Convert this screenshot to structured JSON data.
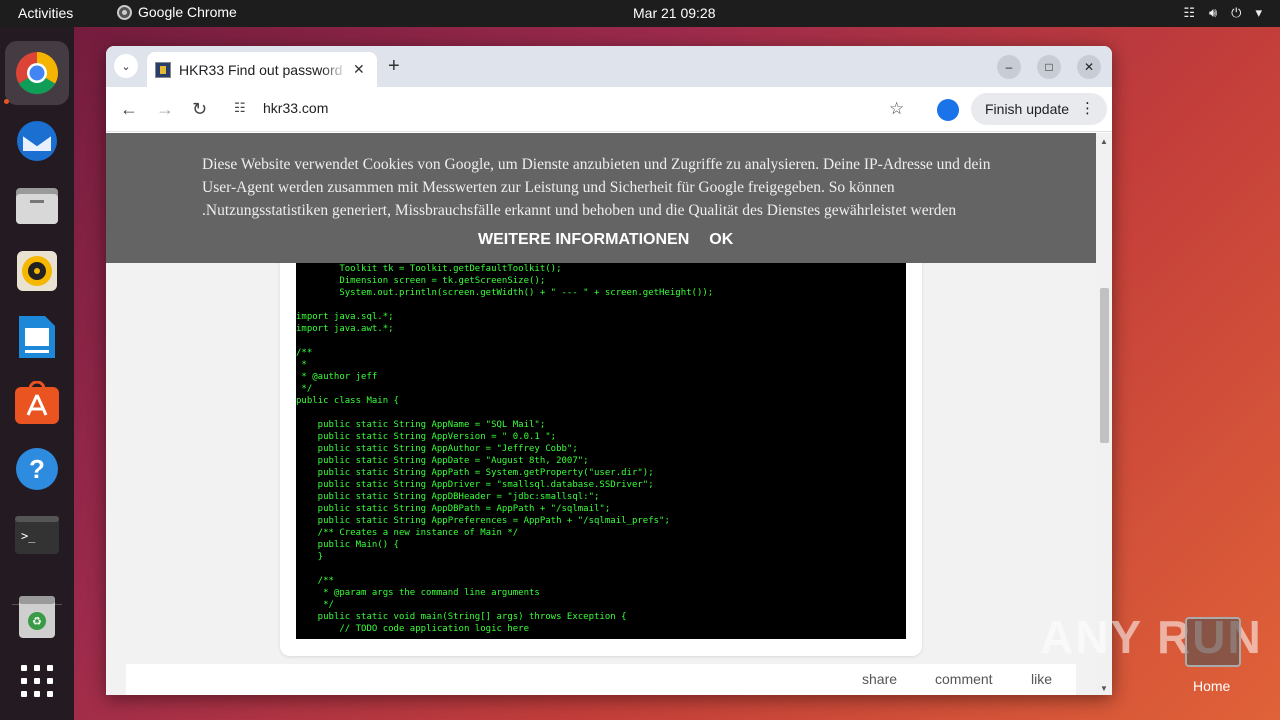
{
  "topbar": {
    "activities": "Activities",
    "app_name": "Google Chrome",
    "clock": "Mar 21  09:28"
  },
  "dock": {
    "items": [
      "chrome-icon",
      "thunderbird-icon",
      "files-icon",
      "rhythmbox-icon",
      "writer-icon",
      "app-center-icon",
      "help-icon",
      "terminal-icon",
      "trash-icon",
      "apps-grid-icon"
    ]
  },
  "browser": {
    "tab_title": "HKR33 Find out password",
    "url": "hkr33.com",
    "finish_update": "Finish update"
  },
  "cookie_banner": {
    "text": "Diese Website verwendet Cookies von Google, um Dienste anzubieten und Zugriffe zu analysieren. Deine IP-Adresse und dein User-Agent werden zusammen mit Messwerten zur Leistung und Sicherheit für Google freigegeben. So können .Nutzungsstatistiken generiert, Missbrauchsfälle erkannt und behoben und die Qualität des Dienstes gewährleistet werden",
    "more_info": "WEITERE INFORMATIONEN",
    "ok": "OK"
  },
  "code_lines": "        Toolkit tk = Toolkit.getDefaultToolkit();\n        Dimension screen = tk.getScreenSize();\n        System.out.println(screen.getWidth() + \" --- \" + screen.getHeight());\n\nimport java.sql.*;\nimport java.awt.*;\n\n/**\n *\n * @author jeff\n */\npublic class Main {\n\n    public static String AppName = \"SQL Mail\";\n    public static String AppVersion = \" 0.0.1 \";\n    public static String AppAuthor = \"Jeffrey Cobb\";\n    public static String AppDate = \"August 8th, 2007\";\n    public static String AppPath = System.getProperty(\"user.dir\");\n    public static String AppDriver = \"smallsql.database.SSDriver\";\n    public static String AppDBHeader = \"jdbc:smallsql:\";\n    public static String AppDBPath = AppPath + \"/sqlmail\";\n    public static String AppPreferences = AppPath + \"/sqlmail_prefs\";\n    /** Creates a new instance of Main */\n    public Main() {\n    }\n\n    /**\n     * @param args the command line arguments\n     */\n    public static void main(String[] args) throws Exception {\n        // TODO code application logic here",
  "footer": {
    "share": "share",
    "comment": "comment",
    "like": "like"
  },
  "watermark": "ANY RUN",
  "desktop": {
    "home_label": "Home"
  }
}
